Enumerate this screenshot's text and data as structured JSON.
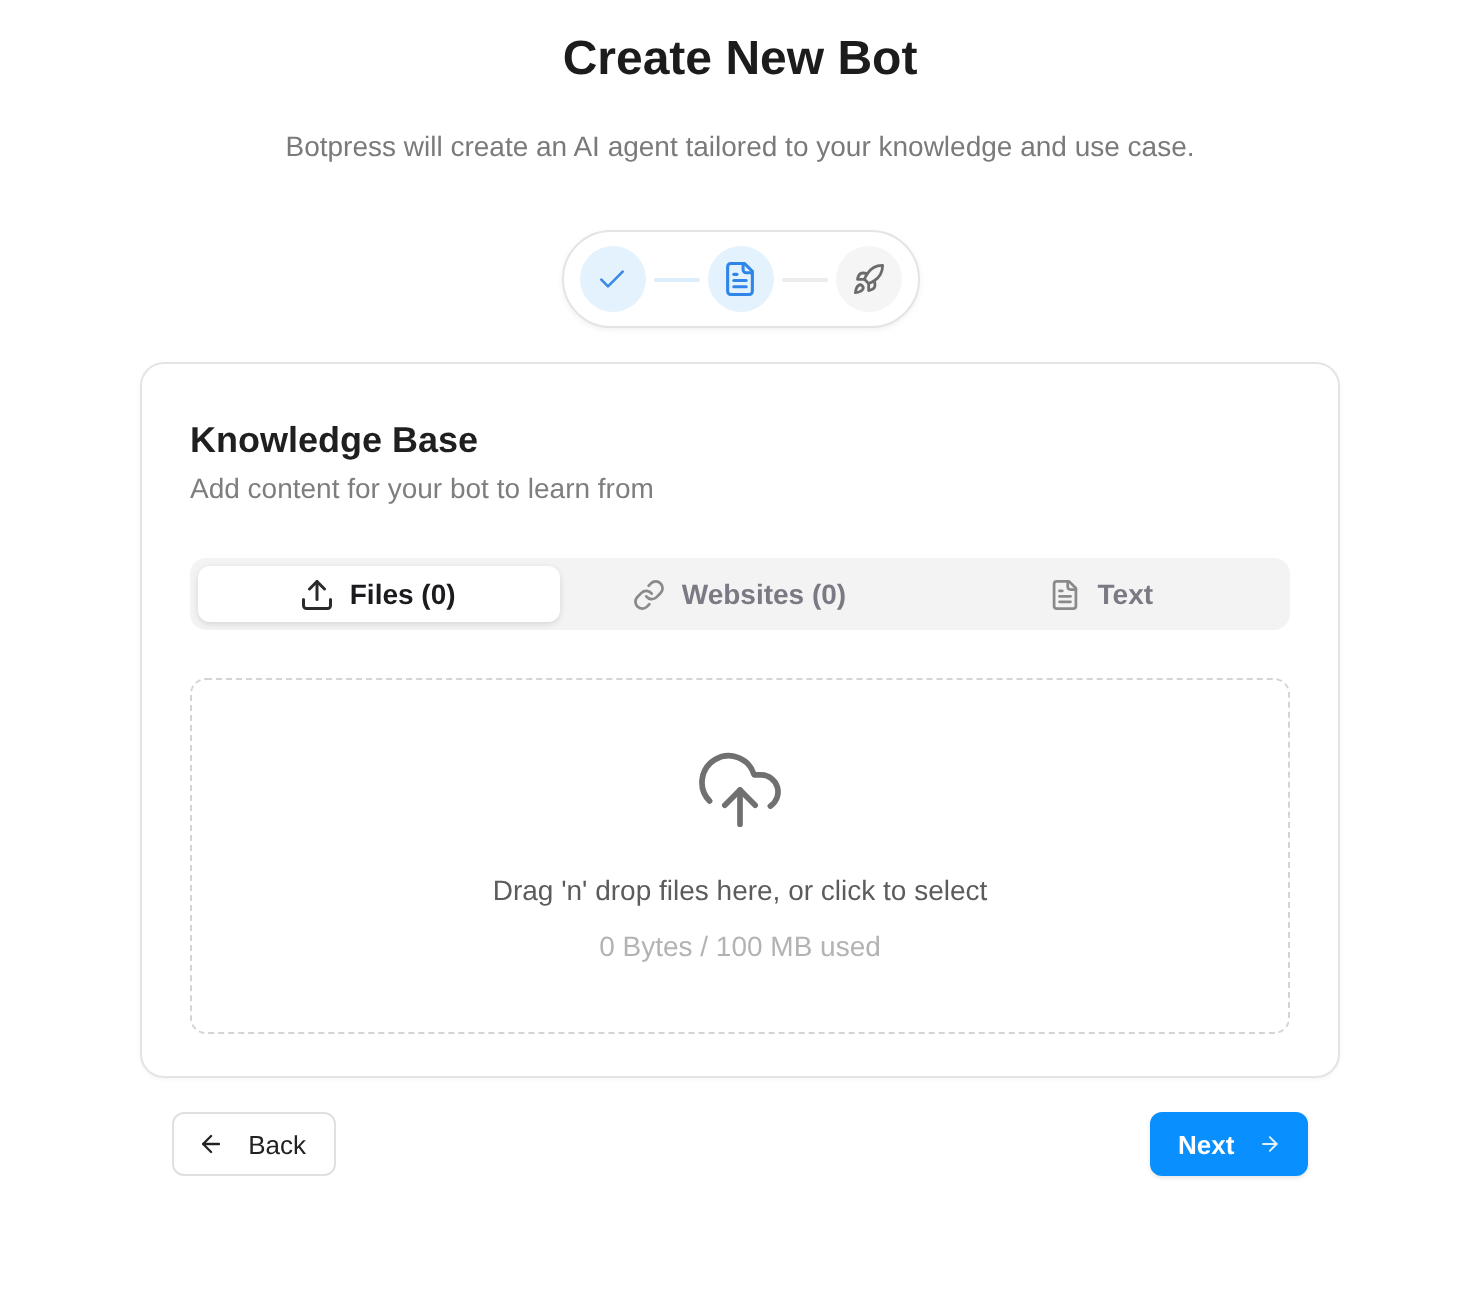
{
  "header": {
    "title": "Create New Bot",
    "subtitle": "Botpress will create an AI agent tailored to your knowledge and use case."
  },
  "stepper": {
    "steps": [
      {
        "completed": true,
        "selected": false
      },
      {
        "completed": false,
        "selected": true
      },
      {
        "completed": false,
        "selected": false
      }
    ]
  },
  "card": {
    "title": "Knowledge Base",
    "subtitle": "Add content for your bot to learn from",
    "tabs": [
      {
        "kind": "files",
        "label": "Files (0)",
        "selected": true
      },
      {
        "kind": "websites",
        "label": "Websites (0)",
        "selected": false
      },
      {
        "kind": "text",
        "label": "Text",
        "selected": false
      }
    ],
    "dropzone": {
      "prompt": "Drag 'n' drop files here, or click to select",
      "usage": "0 Bytes / 100 MB used"
    }
  },
  "footer": {
    "back_label": "Back",
    "next_label": "Next"
  }
}
